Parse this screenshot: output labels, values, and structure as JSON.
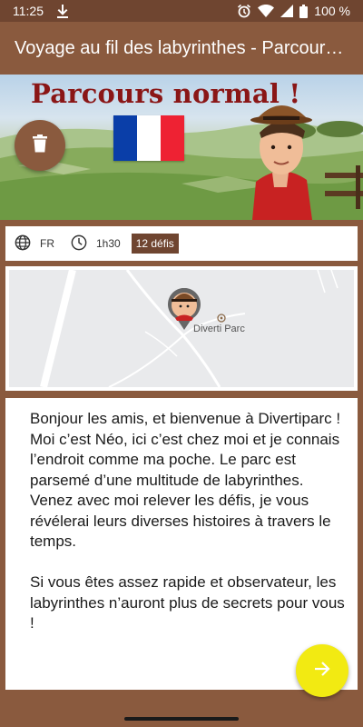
{
  "status_bar": {
    "time": "11:25",
    "battery": "100 %",
    "icons": [
      "download-icon",
      "alarm-icon",
      "wifi-icon",
      "signal-icon",
      "battery-icon"
    ]
  },
  "app_bar": {
    "title": "Voyage au fil des labyrinthes - Parcours normal"
  },
  "hero": {
    "title": "Parcours normal !",
    "flag_colors": [
      "#0a3ea8",
      "#ffffff",
      "#ee2233"
    ]
  },
  "info": {
    "language": "FR",
    "duration": "1h30",
    "challenges": "12 défis",
    "icons": [
      "globe-icon",
      "clock-icon"
    ]
  },
  "map": {
    "poi_label": "Diverti Parc"
  },
  "description": {
    "text": "Bonjour les amis, et bienvenue à Divertiparc ! Moi c’est Néo, ici c’est chez moi et je connais l’endroit comme ma poche. Le parc est parsemé d’une multitude de labyrinthes. Venez avec moi relever les défis, je vous révélerai leurs diverses histoires à travers le temps.\n\nSi vous êtes assez rapide et observateur, les labyrinthes n’auront plus de secrets pour vous !"
  },
  "colors": {
    "primary": "#8a5a3e",
    "primary_dark": "#6f4530",
    "accent": "#f2ea12",
    "hero_title": "#8a1616"
  }
}
